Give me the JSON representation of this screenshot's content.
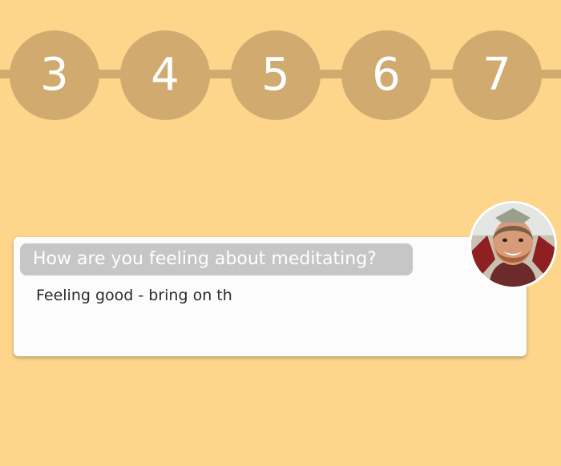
{
  "steps": [
    {
      "label": "3"
    },
    {
      "label": "4"
    },
    {
      "label": "5"
    },
    {
      "label": "6"
    },
    {
      "label": "7"
    }
  ],
  "card": {
    "question": "How are you feeling about meditating?",
    "answer_value": "Feeling good - bring on th"
  },
  "avatar": {
    "icon": "user-avatar-photo"
  },
  "colors": {
    "background": "#fdd58b",
    "step_fill": "#d0aa6f",
    "step_text": "#ffffff",
    "card": "#fcfcfc",
    "question_bg": "#c6c6c6"
  }
}
